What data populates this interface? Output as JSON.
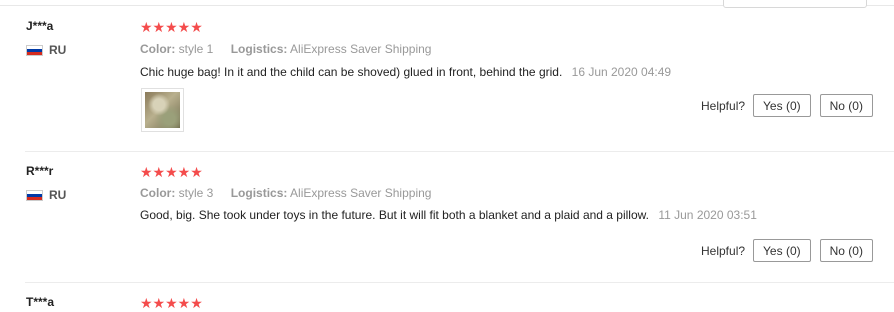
{
  "rating_glyph": "★★★★★",
  "accent_color": "#f44c4c",
  "reviews": [
    {
      "name": "J***a",
      "country": "RU",
      "color_label": "Color:",
      "color_value": "style 1",
      "logistics_label": "Logistics:",
      "logistics_value": "AliExpress Saver Shipping",
      "text": "Chic huge bag! In it and the child can be shoved) glued in front, behind the grid.",
      "date": "16 Jun 2020 04:49",
      "has_photo": true,
      "helpful_label": "Helpful?",
      "yes_label": "Yes (0)",
      "no_label": "No (0)"
    },
    {
      "name": "R***r",
      "country": "RU",
      "color_label": "Color:",
      "color_value": "style 3",
      "logistics_label": "Logistics:",
      "logistics_value": "AliExpress Saver Shipping",
      "text": "Good, big. She took under toys in the future. But it will fit both a blanket and a plaid and a pillow.",
      "date": "11 Jun 2020 03:51",
      "has_photo": false,
      "helpful_label": "Helpful?",
      "yes_label": "Yes (0)",
      "no_label": "No (0)"
    },
    {
      "name": "T***a"
    }
  ]
}
